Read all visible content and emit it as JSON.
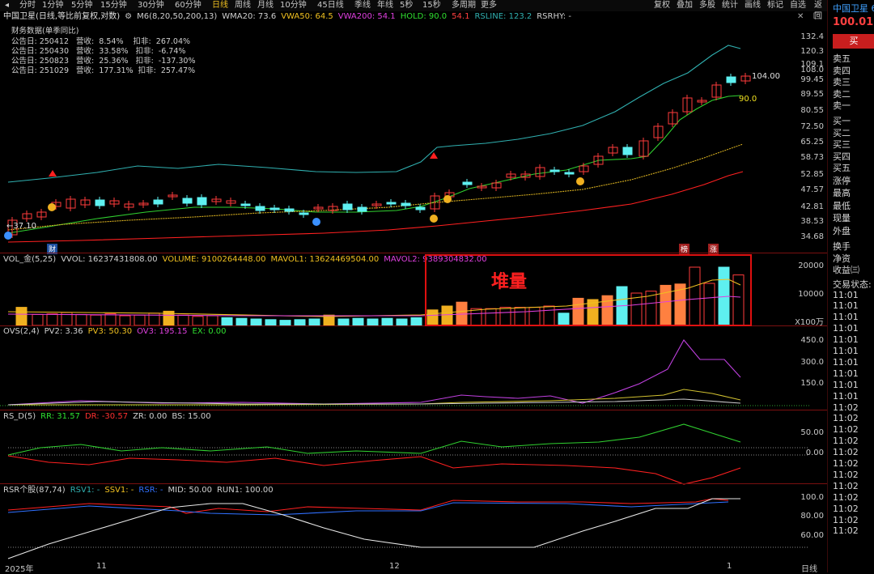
{
  "menu": {
    "periods": [
      "分时",
      "1分钟",
      "5分钟",
      "15分钟",
      "30分钟",
      "60分钟",
      "日线",
      "周线",
      "月线",
      "10分钟",
      "45日线",
      "季线",
      "年线",
      "5秒",
      "15秒",
      "多周期",
      "更多"
    ],
    "active": "日线",
    "right_tools": [
      "复权",
      "叠加",
      "多股",
      "统计",
      "画线",
      "标记",
      "自选",
      "返回"
    ]
  },
  "main_indicator": {
    "title": "中国卫星(日线,等比前复权,对数)",
    "icon": "settings-icon",
    "items": [
      {
        "label": "M6(8,20,50,200,13)",
        "color": "#d0d0d0"
      },
      {
        "label": "WMA20: 73.6",
        "color": "#d0d0d0"
      },
      {
        "label": "VWA50: 64.5",
        "color": "#f0c020"
      },
      {
        "label": "VWA200: 54.1",
        "color": "#e040e0"
      },
      {
        "label": "HOLD: 90.0",
        "color": "#30e030"
      },
      {
        "label": "54.1",
        "color": "#ff4040"
      },
      {
        "label": "RSLINE: 123.2",
        "color": "#30b0b0"
      },
      {
        "label": "RSRHY: -",
        "color": "#d0d0d0"
      }
    ]
  },
  "financials": {
    "header": "财务数据(单季同比)",
    "rows": [
      "公告日: 250412   营收:  8.54%    扣非:  267.04%",
      "公告日: 250430   营收:  33.58%   扣非:  -6.74%",
      "公告日: 250823   营收:  25.36%   扣非:  -137.30%",
      "公告日: 251029   营收:  177.31%  扣非:  257.47%"
    ]
  },
  "price_axis": [
    "132.4",
    "120.3",
    "109.1",
    "108.0",
    "99.45",
    "89.55",
    "80.55",
    "72.50",
    "65.25",
    "58.73",
    "52.85",
    "47.57",
    "42.81",
    "38.53",
    "34.68"
  ],
  "price_labels": {
    "high": "104.00",
    "hold": "90.0",
    "low": "37.10",
    "low_prefix": "←",
    "badge_fin": "财",
    "badge_a": "榜",
    "badge_b": "涨"
  },
  "vol_indicator": {
    "items": [
      {
        "label": "VOL_金(5,25)",
        "color": "#d0d0d0"
      },
      {
        "label": "VVOL: 16237431808.00",
        "color": "#d0d0d0"
      },
      {
        "label": "VOLUME: 9100264448.00",
        "color": "#f0c020"
      },
      {
        "label": "MAVOL1: 13624469504.00",
        "color": "#f0c020"
      },
      {
        "label": "MAVOL2: 9389304832.00",
        "color": "#e040e0"
      }
    ],
    "axis": [
      "20000",
      "10000",
      "X100万"
    ],
    "annotation": "堆量"
  },
  "ovs_indicator": {
    "items": [
      {
        "label": "OVS(2,4)",
        "color": "#d0d0d0"
      },
      {
        "label": "PV2: 3.36",
        "color": "#d0d0d0"
      },
      {
        "label": "PV3: 50.30",
        "color": "#f0c020"
      },
      {
        "label": "OV3: 195.15",
        "color": "#e040e0"
      },
      {
        "label": "EX: 0.00",
        "color": "#30e030"
      }
    ],
    "axis": [
      "450.0",
      "300.0",
      "150.0"
    ]
  },
  "rsd_indicator": {
    "items": [
      {
        "label": "RS_D(5)",
        "color": "#d0d0d0"
      },
      {
        "label": "RR: 31.57",
        "color": "#30e030"
      },
      {
        "label": "DR: -30.57",
        "color": "#ff3030"
      },
      {
        "label": "ZR: 0.00",
        "color": "#d0d0d0"
      },
      {
        "label": "BS: 15.00",
        "color": "#d0d0d0"
      }
    ],
    "axis": [
      "50.00",
      "0.00"
    ]
  },
  "rsr_indicator": {
    "items": [
      {
        "label": "RSR个股(87,74)",
        "color": "#d0d0d0"
      },
      {
        "label": "RSV1: -",
        "color": "#30b0b0"
      },
      {
        "label": "SSV1: -",
        "color": "#f0c020"
      },
      {
        "label": "RSR: -",
        "color": "#3070ff"
      },
      {
        "label": "MID: 50.00",
        "color": "#d0d0d0"
      },
      {
        "label": "RUN1: 100.00",
        "color": "#d0d0d0"
      }
    ],
    "axis": [
      "100.0",
      "80.00",
      "60.00"
    ]
  },
  "x_axis": {
    "labels": [
      "2025年",
      "11",
      "12",
      "1"
    ],
    "period": "日线"
  },
  "side_panel": {
    "stock_name": "中国卫星 6",
    "price": "100.01",
    "buy_label": "买",
    "order_book": [
      "卖五",
      "卖四",
      "卖三",
      "卖二",
      "卖一",
      "买一",
      "买二",
      "买三",
      "买四",
      "买五"
    ],
    "stats": [
      "涨停",
      "最高",
      "最低",
      "现量",
      "外盘"
    ],
    "stats2": [
      "换手",
      "净资",
      "收益㈢"
    ],
    "trade_status": "交易状态: 正",
    "times": [
      "11:01",
      "11:01",
      "11:01",
      "11:01",
      "11:01",
      "11:01",
      "11:01",
      "11:01",
      "11:01",
      "11:01",
      "11:02",
      "11:02",
      "11:02",
      "11:02",
      "11:02",
      "11:02",
      "11:02",
      "11:02",
      "11:02",
      "11:02",
      "11:02",
      "11:02"
    ]
  },
  "colors": {
    "up": "#ff3b3b",
    "down": "#5ef0f0",
    "ma_hold": "#30d030",
    "ma_upper": "#30b0b0",
    "ma_vwa50": "#d8b020",
    "ma_vwa200": "#ff2020",
    "accent_red": "#e01010"
  }
}
